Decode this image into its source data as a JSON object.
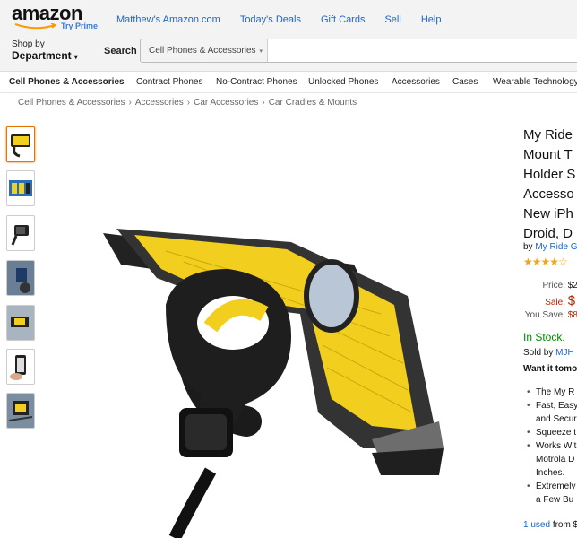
{
  "header": {
    "logo_text": "amazon",
    "logo_subtext": "Try Prime",
    "nav_links": [
      "Matthew's Amazon.com",
      "Today's Deals",
      "Gift Cards",
      "Sell",
      "Help"
    ],
    "department_small": "Shop by",
    "department_big": "Department",
    "search_label": "Search",
    "search_category": "Cell Phones & Accessories",
    "search_value": ""
  },
  "subnav": {
    "items": [
      "Cell Phones & Accessories",
      "Contract Phones",
      "No-Contract Phones",
      "Unlocked Phones",
      "Accessories",
      "Cases",
      "Wearable Technology"
    ]
  },
  "breadcrumb": [
    "Cell Phones & Accessories",
    "Accessories",
    "Car Accessories",
    "Car Cradles & Mounts"
  ],
  "product": {
    "title_lines": [
      "My Ride",
      "Mount T",
      "Holder S",
      "Accesso",
      "New iPh",
      "Droid, D"
    ],
    "by_prefix": "by",
    "brand": "My Ride G",
    "stars": "★★★★☆",
    "price_label": "Price:",
    "price_value": "$2",
    "sale_label": "Sale:",
    "sale_value": "$",
    "save_label": "You Save:",
    "save_value": "$8",
    "stock": "In Stock.",
    "sold_by_prefix": "Sold by",
    "sold_by": "MJH",
    "want_it": "Want it tomo",
    "bullets": [
      [
        "The My R"
      ],
      [
        "Fast, Easy",
        "and Secur"
      ],
      [
        "Squeeze t"
      ],
      [
        "Works Wit",
        "Motrola D",
        "Inches."
      ],
      [
        "Extremely",
        "a Few Bu"
      ]
    ],
    "used_link": "1 used",
    "used_suffix": "from $"
  },
  "colors": {
    "link": "#1a66c8",
    "price_red": "#b12704",
    "stock_green": "#008a00",
    "star": "#f0a51c",
    "header_bg": "#f3f3f3",
    "product_yellow": "#f2cf1e"
  }
}
